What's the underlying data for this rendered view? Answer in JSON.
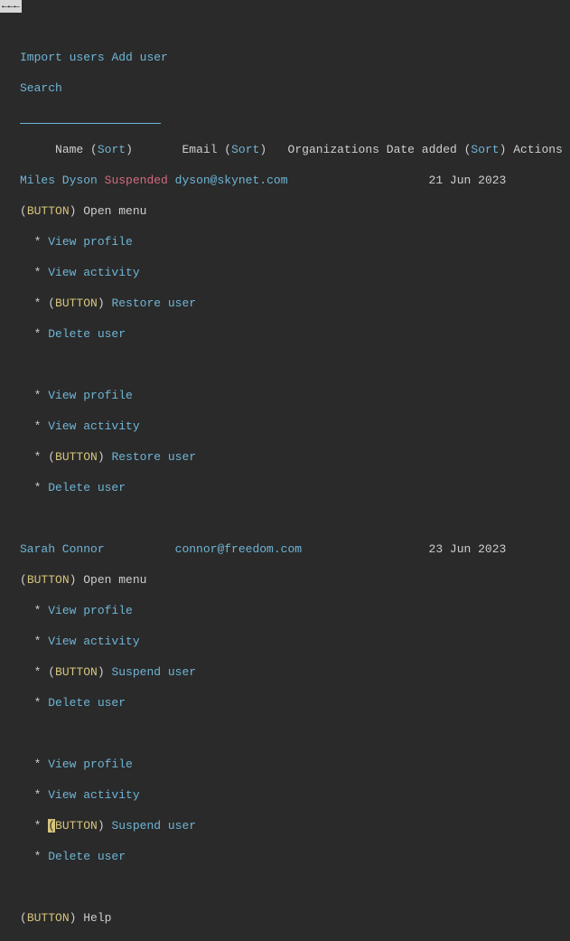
{
  "top_control": "←←←",
  "toolbar": {
    "import_users": "Import users",
    "add_user": "Add user",
    "search": "Search",
    "search_indicator": "____________________"
  },
  "headers": {
    "name": "Name",
    "name_sort": "Sort",
    "email": "Email",
    "email_sort": "Sort",
    "organizations": "Organizations",
    "date_added": "Date added",
    "date_added_sort": "Sort",
    "actions": "Actions"
  },
  "button_label": "BUTTON",
  "open_menu": "Open menu",
  "menu": {
    "view_profile": "View profile",
    "view_activity": "View activity",
    "restore_user": "Restore user",
    "suspend_user": "Suspend user",
    "delete_user": "Delete user"
  },
  "users": [
    {
      "name": "Miles Dyson",
      "status": "Suspended",
      "email": "dyson@skynet.com",
      "date_added": "21 Jun 2023"
    },
    {
      "name": "Sarah Connor",
      "status": "",
      "email": "connor@freedom.com",
      "date_added": "23 Jun 2023"
    }
  ],
  "help": "Help"
}
